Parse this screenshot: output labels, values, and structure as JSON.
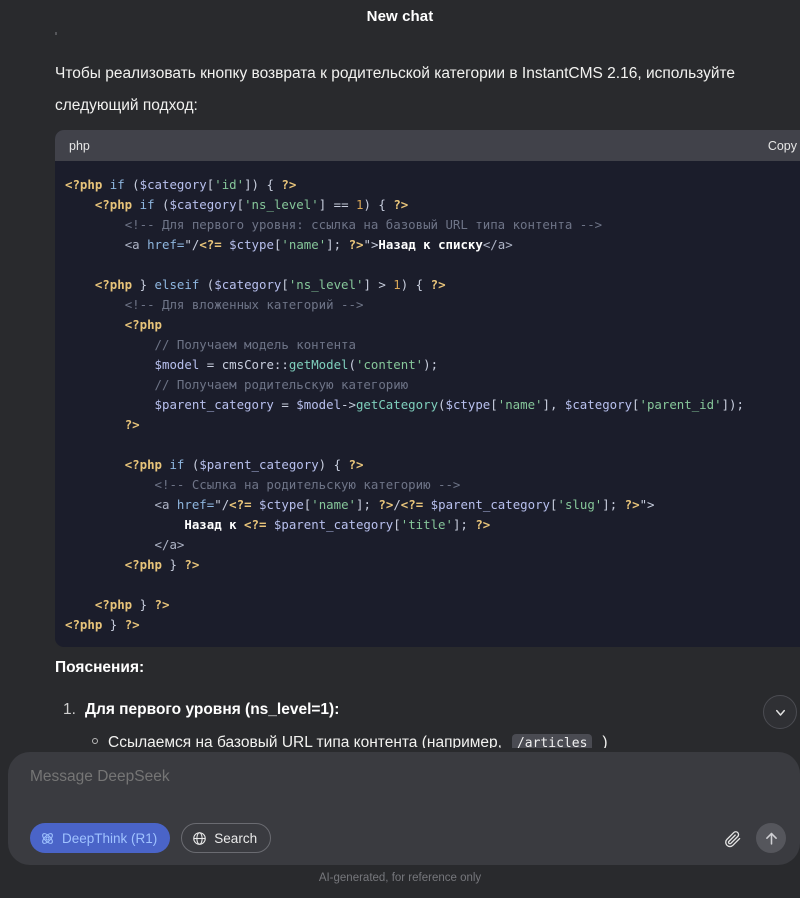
{
  "header": {
    "title": "New chat"
  },
  "conversation": {
    "faded_previous_line": "базовый URL типа контента.",
    "paragraph": "Чтобы реализовать кнопку возврата к родительской категории в InstantCMS 2.16, используйте\nследующий подход:",
    "code_block": {
      "language": "php",
      "copy_label": "Copy",
      "lines": [
        "<?php if ($category['id']) { ?>",
        "    <?php if ($category['ns_level'] == 1) { ?>",
        "        <!-- Для первого уровня: ссылка на базовый URL типа контента -->",
        "        <a href=\"/<?= $ctype['name']; ?>\">Назад к списку</a>",
        "",
        "    <?php } elseif ($category['ns_level'] > 1) { ?>",
        "        <!-- Для вложенных категорий -->",
        "        <?php",
        "            // Получаем модель контента",
        "            $model = cmsCore::getModel('content');",
        "            // Получаем родительскую категорию",
        "            $parent_category = $model->getCategory($ctype['name'], $category['parent_id']);",
        "        ?>",
        "",
        "        <?php if ($parent_category) { ?>",
        "            <!-- Ссылка на родительскую категорию -->",
        "            <a href=\"/<?= $ctype['name']; ?>/<?= $parent_category['slug']; ?>\">",
        "                Назад к <?= $parent_category['title']; ?>",
        "            </a>",
        "        <?php } ?>",
        "",
        "    <?php } ?>",
        "<?php } ?>"
      ]
    },
    "explanations_heading": "Пояснения:",
    "ordered_item_number": "1.",
    "ordered_item_text": "Для первого уровня (ns_level=1):",
    "bullet_text_before": "Ссылаемся на базовый URL типа контента (например,",
    "bullet_inline_code": "/articles",
    "bullet_text_after": ")"
  },
  "scroll_button": {
    "icon": "chevron-down-icon"
  },
  "composer": {
    "placeholder": "Message DeepSeek",
    "value": "",
    "deepthink_label": "DeepThink (R1)",
    "deepthink_icon": "atom-icon",
    "search_label": "Search",
    "search_icon": "globe-icon",
    "attach_icon": "paperclip-icon",
    "send_icon": "arrow-up-icon",
    "disclaimer": "AI-generated, for reference only"
  },
  "colors": {
    "page_bg": "#292a2d",
    "code_bg": "#1b1d2b",
    "code_head_bg": "#41424a",
    "composer_bg": "#3a3b40",
    "accent_blue": "#4a64c8",
    "accent_blue_text": "#9fc2ff"
  }
}
